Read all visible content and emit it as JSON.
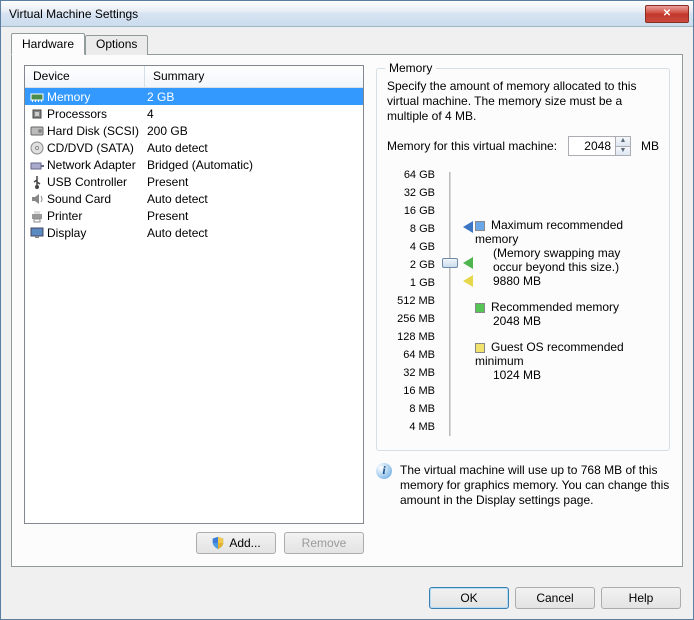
{
  "window": {
    "title": "Virtual Machine Settings"
  },
  "tabs": {
    "hardware": "Hardware",
    "options": "Options"
  },
  "list": {
    "headers": {
      "device": "Device",
      "summary": "Summary"
    },
    "items": [
      {
        "device": "Memory",
        "summary": "2 GB",
        "icon": "memory-icon",
        "selected": true
      },
      {
        "device": "Processors",
        "summary": "4",
        "icon": "cpu-icon"
      },
      {
        "device": "Hard Disk (SCSI)",
        "summary": "200 GB",
        "icon": "hdd-icon"
      },
      {
        "device": "CD/DVD (SATA)",
        "summary": "Auto detect",
        "icon": "cd-icon"
      },
      {
        "device": "Network Adapter",
        "summary": "Bridged (Automatic)",
        "icon": "net-icon"
      },
      {
        "device": "USB Controller",
        "summary": "Present",
        "icon": "usb-icon"
      },
      {
        "device": "Sound Card",
        "summary": "Auto detect",
        "icon": "sound-icon"
      },
      {
        "device": "Printer",
        "summary": "Present",
        "icon": "printer-icon"
      },
      {
        "device": "Display",
        "summary": "Auto detect",
        "icon": "display-icon"
      }
    ]
  },
  "buttons": {
    "add": "Add...",
    "remove": "Remove",
    "ok": "OK",
    "cancel": "Cancel",
    "help": "Help"
  },
  "memory": {
    "group": "Memory",
    "desc": "Specify the amount of memory allocated to this virtual machine. The memory size must be a multiple of 4 MB.",
    "label": "Memory for this virtual machine:",
    "value": "2048",
    "unit": "MB",
    "ticks": [
      "64 GB",
      "32 GB",
      "16 GB",
      "8 GB",
      "4 GB",
      "2 GB",
      "1 GB",
      "512 MB",
      "256 MB",
      "128 MB",
      "64 MB",
      "32 MB",
      "16 MB",
      "8 MB",
      "4 MB"
    ],
    "legend": {
      "max": {
        "title": "Maximum recommended memory",
        "sub1": "(Memory swapping may",
        "sub2": "occur beyond this size.)",
        "val": "9880 MB",
        "color": "#6aa7e8"
      },
      "rec": {
        "title": "Recommended memory",
        "val": "2048 MB",
        "color": "#57c457"
      },
      "min": {
        "title": "Guest OS recommended minimum",
        "val": "1024 MB",
        "color": "#f1e36b"
      }
    },
    "info": "The virtual machine will use up to 768 MB of this memory for graphics memory. You can change this amount in the Display settings page."
  }
}
